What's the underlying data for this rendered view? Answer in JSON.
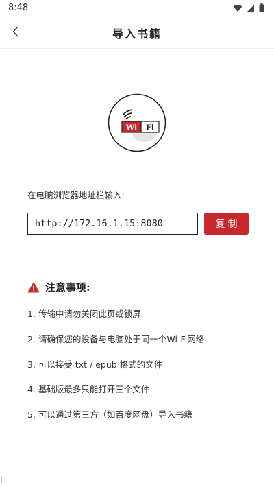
{
  "status_bar": {
    "time": "8:48"
  },
  "header": {
    "title": "导入书籍"
  },
  "wifi_logo": {
    "left_text": "Wi",
    "right_text": "Fi",
    "accent": "#c8272e"
  },
  "main": {
    "instruction": "在电脑浏览器地址栏输入:",
    "url_value": "http://172.16.1.15:8080",
    "copy_label": "复制"
  },
  "notice": {
    "title": "注意事项:",
    "items": [
      "1. 传输中请勿关闭此页或锁屏",
      "2. 请确保您的设备与电脑处于同一个Wi-Fi网络",
      "3. 可以接受 txt / epub 格式的文件",
      "4. 基础版最多只能打开三个文件",
      "5. 可以通过第三方（如百度网盘）导入书籍"
    ]
  },
  "colors": {
    "accent": "#c8272e",
    "text": "#222222",
    "background": "#ffffff"
  }
}
